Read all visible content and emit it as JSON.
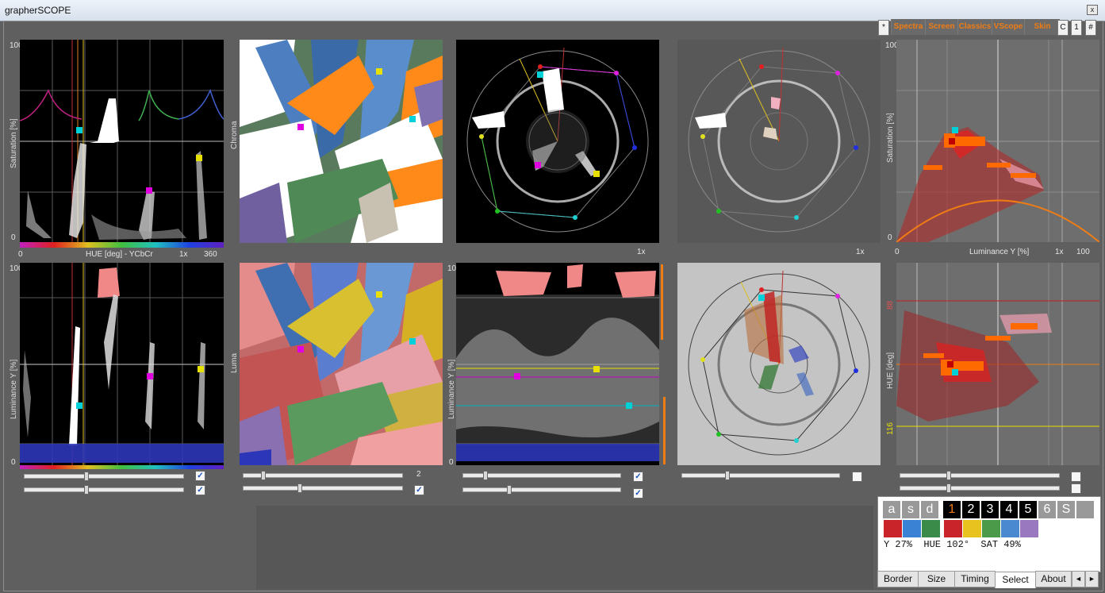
{
  "window": {
    "title": "grapherSCOPE",
    "close_label": "x"
  },
  "toolbar": {
    "star": "*",
    "buttons": [
      "Spectra",
      "Screen",
      "Classics",
      "VScope",
      "Skin"
    ],
    "small_buttons": [
      "C",
      "1",
      "#"
    ]
  },
  "hue_sat": {
    "y_top": "100",
    "y_bottom": "0",
    "ylabel": "Saturation [%]",
    "x_left": "0",
    "xlabel": "HUE [deg] - YCbCr",
    "zoom": "1x",
    "x_right": "360"
  },
  "chroma_img": {
    "ylabel": "Chroma"
  },
  "vector1": {
    "zoom": "1x"
  },
  "vector2": {
    "zoom": "1x"
  },
  "lum_sat": {
    "y_top": "100",
    "ylabel": "Saturation [%]",
    "y_bottom": "0",
    "x_left": "0",
    "xlabel": "Luminance Y [%]",
    "zoom": "1x",
    "x_right": "100"
  },
  "hue_lum": {
    "y_top": "100",
    "ylabel": "Luminance Y [%]",
    "y_bottom": "0"
  },
  "luma_img": {
    "ylabel": "Luma",
    "slider_value": "2"
  },
  "waveform": {
    "y_top": "100",
    "ylabel": "Luminance Y [%]",
    "y_bottom": "0"
  },
  "lum_hue": {
    "ylabel": "HUE [deg]",
    "mark_top": "88",
    "mark_bottom": "116"
  },
  "select_panel": {
    "keys": [
      "a",
      "s",
      "d",
      "1",
      "2",
      "3",
      "4",
      "5",
      "6",
      "S"
    ],
    "swatches_left": [
      "#c8242a",
      "#3a82d4",
      "#3a8a4a"
    ],
    "swatches_right": [
      "#c8242a",
      "#e8c21e",
      "#4a9a4a",
      "#4a88d0",
      "#9a78c0"
    ],
    "readout": "Y 27%  HUE 102°  SAT 49%"
  },
  "tabs": [
    "Border",
    "Size",
    "Timing",
    "Select",
    "About"
  ],
  "tab_arrows": [
    "◄",
    "►"
  ],
  "colors": {
    "accent": "#f07c14",
    "cyan": "#00d0d8",
    "magenta": "#e000e0",
    "yellow": "#e8e000"
  }
}
